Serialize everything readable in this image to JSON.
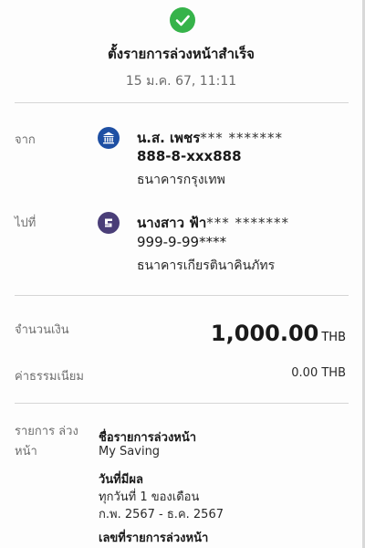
{
  "header": {
    "title": "ตั้งรายการล่วงหน้าสำเร็จ",
    "datetime": "15 ม.ค. 67, 11:11"
  },
  "from": {
    "label": "จาก",
    "name": "น.ส. เพชร",
    "name_mask": "*** *******",
    "account": "888-8-xxx888",
    "bank": "ธนาคารกรุงเทพ",
    "icon": "bank-icon",
    "icon_color": "#1e4fa3"
  },
  "to": {
    "label": "ไปที่",
    "name": "นางสาว ฟ้า",
    "name_mask": "*** *******",
    "account": "999-9-99****",
    "bank": "ธนาคารเกียรตินาคินภัทร",
    "icon": "kkp-bank-icon",
    "icon_color": "#4a3e78"
  },
  "amount": {
    "label": "จำนวนเงิน",
    "value": "1,000.00",
    "currency": "THB"
  },
  "fee": {
    "label": "ค่าธรรมเนียม",
    "value": "0.00 THB"
  },
  "schedule": {
    "label": "รายการ ล่วงหน้า",
    "name_heading": "ชื่อรายการล่วงหน้า",
    "name_value": "My Saving",
    "effective_heading": "วันที่มีผล",
    "effective_line1": "ทุกวันที่ 1 ของเดือน",
    "effective_line2": "ก.พ. 2567 - ธ.ค. 2567",
    "ref_heading": "เลขที่รายการล่วงหน้า"
  },
  "colors": {
    "success": "#36b34a"
  }
}
